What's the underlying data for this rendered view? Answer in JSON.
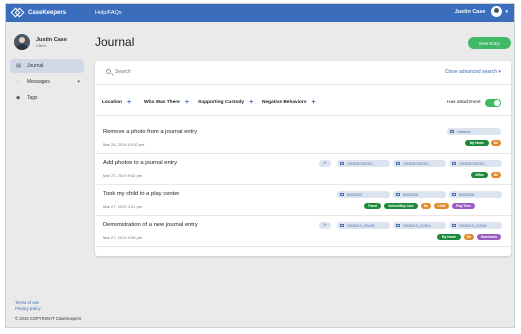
{
  "topbar": {
    "app_name": "CaseKeepers",
    "nav_link": "Help/FAQs",
    "user_name": "Justin Case",
    "user_menu_caret": "▾",
    "background": "#3a6dbb"
  },
  "sidebar": {
    "profile": {
      "name": "Justin Case",
      "role": "Client"
    },
    "items": [
      {
        "label": "Journal",
        "icon": "book-icon",
        "glyph": "▤",
        "active": true
      },
      {
        "label": "Messages",
        "icon": "chat-icon",
        "glyph": "◌",
        "caret": "▾"
      },
      {
        "label": "Tags",
        "icon": "tag-icon",
        "glyph": "◆"
      }
    ],
    "footer": {
      "terms": "Terms of use",
      "privacy": "Privacy policy",
      "copyright": "© 2019 COPYRIGHT CaseKeepers"
    }
  },
  "main": {
    "title": "Journal",
    "new_entry_label": "New Entry",
    "search": {
      "placeholder": "Search",
      "advanced_link": "Close advanced search  ▾"
    },
    "filters": [
      {
        "label": "Location",
        "plus": "+"
      },
      {
        "label": "Who Was There",
        "plus": "+"
      },
      {
        "label": "Supporting Custody",
        "plus": "+"
      },
      {
        "label": "Negative Behaviors",
        "plus": "+"
      }
    ],
    "has_attachment": {
      "label": "Has attachment",
      "on": true
    },
    "accent_color": "#3fb868",
    "entries": [
      {
        "title": "Remove a photo from a journal entry",
        "date": "Mar 28, 2019 10:00 pm",
        "more": "",
        "attachments": [
          "Fakeface"
        ],
        "tags": [
          {
            "label": "My Home",
            "color": "#1d8a3a"
          },
          {
            "label": "Me",
            "color": "#e08a2c"
          }
        ]
      },
      {
        "title": "Add photos to a journal entry",
        "date": "Mar 27, 2019 9:52 pm",
        "more": "3+",
        "attachments": [
          "20190327093327...",
          "20190327093327...",
          "20190327093327..."
        ],
        "tags": [
          {
            "label": "Office",
            "color": "#1d8a3a"
          },
          {
            "label": "Me",
            "color": "#e08a2c"
          }
        ]
      },
      {
        "title": "Took my child to a play center",
        "date": "Mar 27, 2019 3:31 pm",
        "more": "",
        "attachments": [
          "IMG00007",
          "IMG00005",
          "IMG00006"
        ],
        "tags": [
          {
            "label": "Travel",
            "color": "#1d8a3a"
          },
          {
            "label": "School/Day Care",
            "color": "#1d8a3a"
          },
          {
            "label": "Me",
            "color": "#e08a2c"
          },
          {
            "label": "Child",
            "color": "#e08a2c"
          },
          {
            "label": "Play Time",
            "color": "#9a5cc0"
          }
        ]
      },
      {
        "title": "Demonstration of a new journal entry",
        "date": "Mar 27, 2019 3:08 pm",
        "more": "3+",
        "attachments": [
          "20190219_105435",
          "20190219_102819",
          "20190219_102849"
        ],
        "tags": [
          {
            "label": "My Home",
            "color": "#1d8a3a"
          },
          {
            "label": "Me",
            "color": "#e08a2c"
          },
          {
            "label": "Homework",
            "color": "#9a5cc0"
          }
        ]
      }
    ]
  }
}
